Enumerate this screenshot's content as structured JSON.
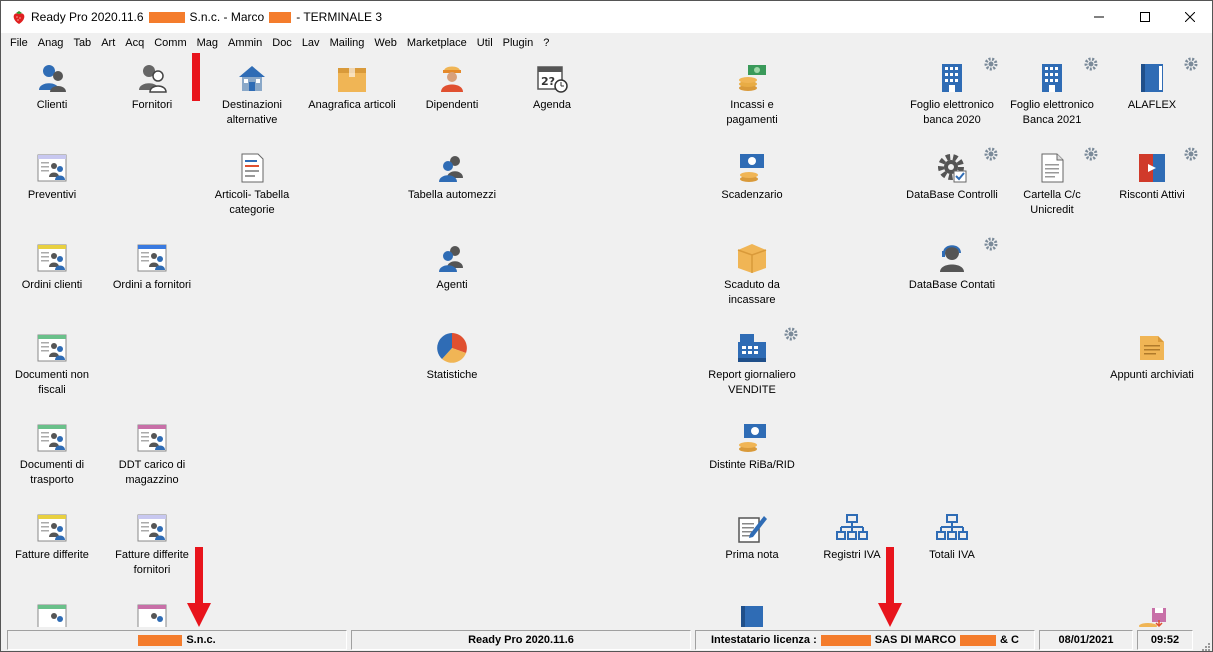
{
  "window": {
    "title_prefix": "Ready Pro 2020.11.6",
    "title_company": "S.n.c. - Marco",
    "title_suffix": "- TERMINALE 3"
  },
  "menu": [
    "File",
    "Anag",
    "Tab",
    "Art",
    "Acq",
    "Comm",
    "Mag",
    "Ammin",
    "Doc",
    "Lav",
    "Mailing",
    "Web",
    "Marketplace",
    "Util",
    "Plugin",
    "?"
  ],
  "tiles": {
    "clienti": "Clienti",
    "fornitori": "Fornitori",
    "destinazioni": "Destinazioni\nalternative",
    "anagrafica_articoli": "Anagrafica articoli",
    "dipendenti": "Dipendenti",
    "agenda": "Agenda",
    "incassi": "Incassi e\npagamenti",
    "foglio_2020": "Foglio elettronico\nbanca 2020",
    "foglio_2021": "Foglio elettronico\nBanca 2021",
    "alaflex": "ALAFLEX",
    "preventivi": "Preventivi",
    "articoli_tabella": "Articoli- Tabella\ncategorie",
    "tabella_automezzi": "Tabella automezzi",
    "scadenzario": "Scadenzario",
    "database_controlli": "DataBase Controlli",
    "cartella_unicredit": "Cartella C/c\nUnicredit",
    "risconti_attivi": "Risconti Attivi",
    "ordini_clienti": "Ordini clienti",
    "ordini_fornitori": "Ordini a fornitori",
    "agenti": "Agenti",
    "scaduto": "Scaduto da\nincassare",
    "database_contati": "DataBase Contati",
    "documenti_non_fiscali": "Documenti non\nfiscali",
    "statistiche": "Statistiche",
    "report_giornaliero": "Report giornaliero\nVENDITE",
    "appunti_archiviati": "Appunti archiviati",
    "documenti_trasporto": "Documenti di\ntrasporto",
    "ddt_carico": "DDT carico di\nmagazzino",
    "distinte_riba": "Distinte RiBa/RID",
    "fatture_differite": "Fatture differite",
    "fatture_differite_fornitori": "Fatture differite\nfornitori",
    "prima_nota": "Prima nota",
    "registri_iva": "Registri IVA",
    "totali_iva": "Totali IVA"
  },
  "status": {
    "company": "S.n.c.",
    "version": "Ready Pro 2020.11.6",
    "license_label": "Intestatario licenza :",
    "license_company": "SAS DI MARCO",
    "license_suffix": "& C",
    "date": "08/01/2021",
    "time": "09:52"
  },
  "colors": {
    "redaction": "#f47c2c",
    "arrow": "#e8141c",
    "icon_blue": "#2f6cb5",
    "icon_orange": "#f0b555"
  }
}
